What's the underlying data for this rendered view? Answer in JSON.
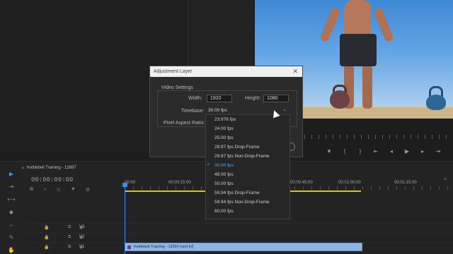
{
  "dialog": {
    "title": "Adjustment Layer",
    "section": "Video Settings",
    "width_label": "Width:",
    "width_value": "1920",
    "height_label": "Height:",
    "height_value": "1080",
    "timebase_label": "Timebase:",
    "timebase_value": "30.00 fps",
    "par_label": "Pixel Aspect Ratio:"
  },
  "timebase_options": [
    "23.976 fps",
    "24.00 fps",
    "25.00 fps",
    "29.97 fps Drop-Frame",
    "29.97 fps Non-Drop-Frame",
    "30.00 fps",
    "48.00 fps",
    "50.00 fps",
    "59.94 fps Drop-Frame",
    "59.94 fps Non-Drop-Frame",
    "60.00 fps"
  ],
  "selected_option": "30.00 fps",
  "timeline": {
    "sequence_name": "Kettlebell Training - 12697",
    "timecode": "00:00:00:00",
    "ruler_labels": [
      "00:00",
      "00:00:15:00",
      "00:00:45:00",
      "00:01:00:00",
      "00:01:15:00"
    ],
    "tracks": [
      "V3",
      "V2",
      "V1"
    ],
    "clip_name": "Kettlebell Training - 12697.mp4 [V]"
  },
  "icons": {
    "close": "✕",
    "chevron": "⌄",
    "check": "✓"
  }
}
